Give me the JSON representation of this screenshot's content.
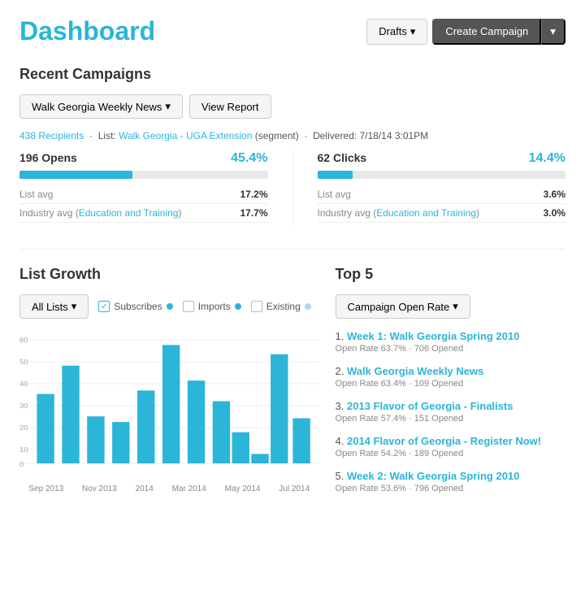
{
  "header": {
    "title": "Dashboard",
    "drafts_label": "Drafts",
    "create_campaign_label": "Create Campaign"
  },
  "recent_campaigns": {
    "section_title": "Recent Campaigns",
    "campaign_selector_label": "Walk Georgia Weekly News",
    "view_report_label": "View Report",
    "meta": {
      "recipients": "438 Recipients",
      "list_link_text": "Walk Georgia - UGA Extension",
      "list_segment": "(segment)",
      "delivered": "Delivered: 7/18/14 3:01PM"
    },
    "opens": {
      "label": "196 Opens",
      "pct": "45.4%",
      "bar_width": "45.4",
      "list_avg_label": "List avg",
      "list_avg_val": "17.2%",
      "industry_avg_label": "Industry avg",
      "industry_avg_link": "Education and Training",
      "industry_avg_val": "17.7%"
    },
    "clicks": {
      "label": "62 Clicks",
      "pct": "14.4%",
      "bar_width": "14.4",
      "list_avg_label": "List avg",
      "list_avg_val": "3.6%",
      "industry_avg_label": "Industry avg",
      "industry_avg_link": "Education and Training",
      "industry_avg_val": "3.0%"
    }
  },
  "list_growth": {
    "section_title": "List Growth",
    "all_lists_label": "All Lists",
    "subscribes_label": "Subscribes",
    "imports_label": "Imports",
    "existing_label": "Existing",
    "chart_labels": [
      "Sep 2013",
      "Nov 2013",
      "2014",
      "Mar 2014",
      "May 2014",
      "Jul 2014"
    ],
    "bars": [
      37,
      52,
      25,
      22,
      39,
      63,
      44,
      33,
      17,
      5,
      58,
      24
    ]
  },
  "top5": {
    "section_title": "Top 5",
    "filter_label": "Campaign Open Rate",
    "items": [
      {
        "num": "1.",
        "title": "Week 1: Walk Georgia Spring 2010",
        "meta": "Open Rate 63.7% · 706 Opened"
      },
      {
        "num": "2.",
        "title": "Walk Georgia Weekly News",
        "meta": "Open Rate 63.4% · 109 Opened"
      },
      {
        "num": "3.",
        "title": "2013 Flavor of Georgia - Finalists",
        "meta": "Open Rate 57.4% · 151 Opened"
      },
      {
        "num": "4.",
        "title": "2014 Flavor of Georgia - Register Now!",
        "meta": "Open Rate 54.2% · 189 Opened"
      },
      {
        "num": "5.",
        "title": "Week 2: Walk Georgia Spring 2010",
        "meta": "Open Rate 53.6% · 796 Opened"
      }
    ]
  }
}
